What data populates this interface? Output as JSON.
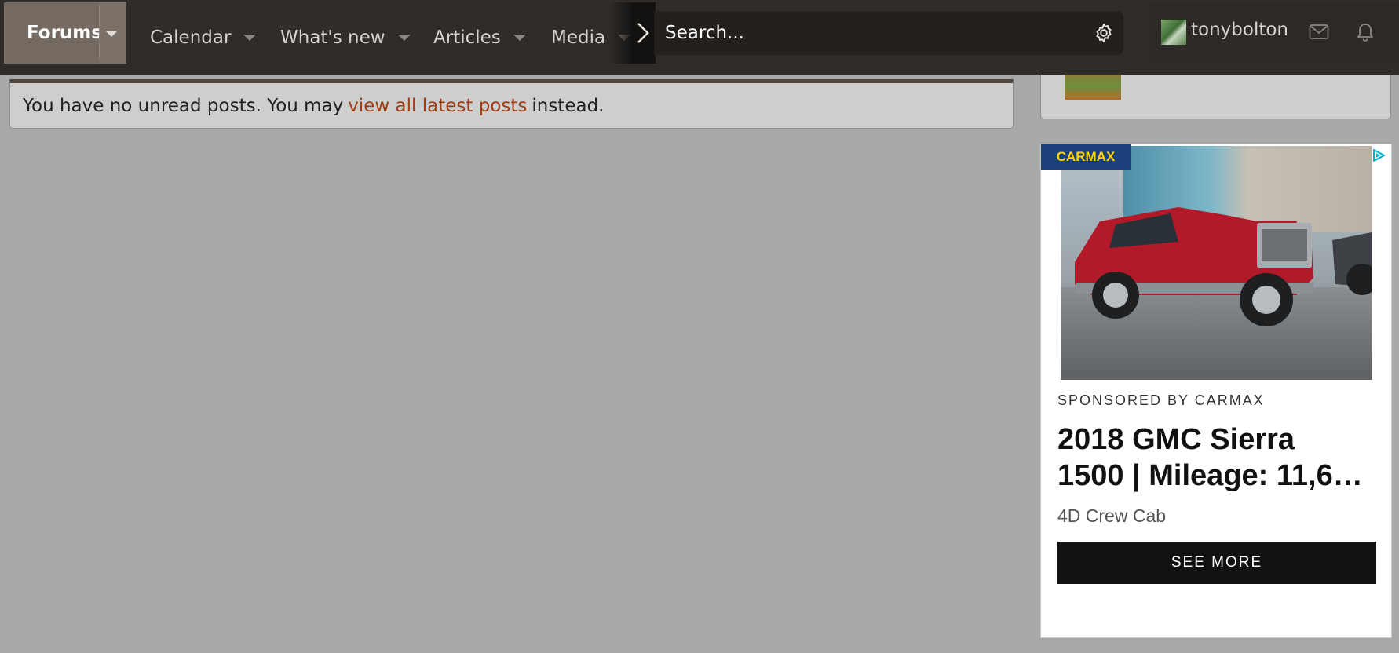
{
  "nav": {
    "tabs": [
      {
        "label": "Forums"
      },
      {
        "label": "Calendar"
      },
      {
        "label": "What's new"
      },
      {
        "label": "Articles"
      },
      {
        "label": "Media"
      }
    ],
    "search": {
      "placeholder": "Search..."
    },
    "user": {
      "name": "tonybolton"
    },
    "colors": {
      "nav_bg": "#2f2c29",
      "active_tab": "#756a61",
      "link": "#a23d12"
    }
  },
  "notice": {
    "prefix": "You have no unread posts. You may",
    "link_text": "view all latest posts",
    "suffix": "instead."
  },
  "ad": {
    "logo": "CARMAX",
    "sponsor": "SPONSORED BY CARMAX",
    "headline": "2018 GMC Sierra\n1500 | Mileage: 11,6…",
    "subtitle": "4D Crew Cab",
    "cta": "SEE MORE"
  }
}
